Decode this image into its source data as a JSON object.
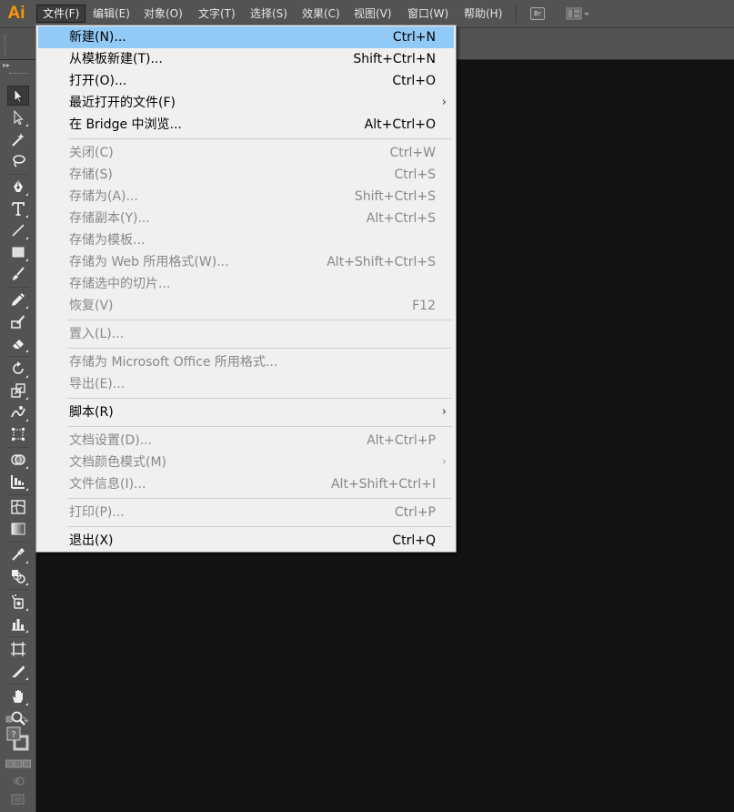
{
  "app": {
    "logo": "Ai",
    "bridge_label": "Br"
  },
  "menubar": {
    "items": [
      {
        "label": "文件(F)"
      },
      {
        "label": "编辑(E)"
      },
      {
        "label": "对象(O)"
      },
      {
        "label": "文字(T)"
      },
      {
        "label": "选择(S)"
      },
      {
        "label": "效果(C)"
      },
      {
        "label": "视图(V)"
      },
      {
        "label": "窗口(W)"
      },
      {
        "label": "帮助(H)"
      }
    ]
  },
  "file_menu": {
    "items": [
      {
        "label": "新建(N)...",
        "shortcut": "Ctrl+N",
        "enabled": true,
        "highlighted": true
      },
      {
        "label": "从模板新建(T)...",
        "shortcut": "Shift+Ctrl+N",
        "enabled": true
      },
      {
        "label": "打开(O)...",
        "shortcut": "Ctrl+O",
        "enabled": true
      },
      {
        "label": "最近打开的文件(F)",
        "shortcut": "",
        "enabled": true,
        "submenu": true
      },
      {
        "label": "在 Bridge 中浏览...",
        "shortcut": "Alt+Ctrl+O",
        "enabled": true
      },
      {
        "label": "关闭(C)",
        "shortcut": "Ctrl+W",
        "enabled": false
      },
      {
        "label": "存储(S)",
        "shortcut": "Ctrl+S",
        "enabled": false
      },
      {
        "label": "存储为(A)...",
        "shortcut": "Shift+Ctrl+S",
        "enabled": false
      },
      {
        "label": "存储副本(Y)...",
        "shortcut": "Alt+Ctrl+S",
        "enabled": false
      },
      {
        "label": "存储为模板...",
        "shortcut": "",
        "enabled": false
      },
      {
        "label": "存储为 Web 所用格式(W)...",
        "shortcut": "Alt+Shift+Ctrl+S",
        "enabled": false
      },
      {
        "label": "存储选中的切片...",
        "shortcut": "",
        "enabled": false
      },
      {
        "label": "恢复(V)",
        "shortcut": "F12",
        "enabled": false
      },
      {
        "label": "置入(L)...",
        "shortcut": "",
        "enabled": false
      },
      {
        "label": "存储为 Microsoft Office 所用格式...",
        "shortcut": "",
        "enabled": false
      },
      {
        "label": "导出(E)...",
        "shortcut": "",
        "enabled": false
      },
      {
        "label": "脚本(R)",
        "shortcut": "",
        "enabled": true,
        "submenu": true
      },
      {
        "label": "文档设置(D)...",
        "shortcut": "Alt+Ctrl+P",
        "enabled": false
      },
      {
        "label": "文档颜色模式(M)",
        "shortcut": "",
        "enabled": false,
        "submenu": true
      },
      {
        "label": "文件信息(I)...",
        "shortcut": "Alt+Shift+Ctrl+I",
        "enabled": false
      },
      {
        "label": "打印(P)...",
        "shortcut": "Ctrl+P",
        "enabled": false
      },
      {
        "label": "退出(X)",
        "shortcut": "Ctrl+Q",
        "enabled": true
      }
    ]
  },
  "tools": [
    "selection-tool",
    "direct-selection-tool",
    "magic-wand-tool",
    "lasso-tool",
    "pen-tool",
    "type-tool",
    "line-segment-tool",
    "rectangle-tool",
    "paintbrush-tool",
    "pencil-tool",
    "blob-brush-tool",
    "eraser-tool",
    "rotate-tool",
    "scale-tool",
    "warp-tool",
    "free-transform-tool",
    "shape-builder-tool",
    "perspective-grid-tool",
    "mesh-tool",
    "gradient-tool",
    "eyedropper-tool",
    "blend-tool",
    "symbol-sprayer-tool",
    "column-graph-tool",
    "artboard-tool",
    "slice-tool",
    "hand-tool",
    "zoom-tool"
  ],
  "colors": {
    "menubar_bg": "#535353",
    "canvas_bg": "#121212",
    "menu_bg": "#f0f0f0",
    "menu_highlight": "#91c9f7",
    "logo": "#ff9a00"
  }
}
